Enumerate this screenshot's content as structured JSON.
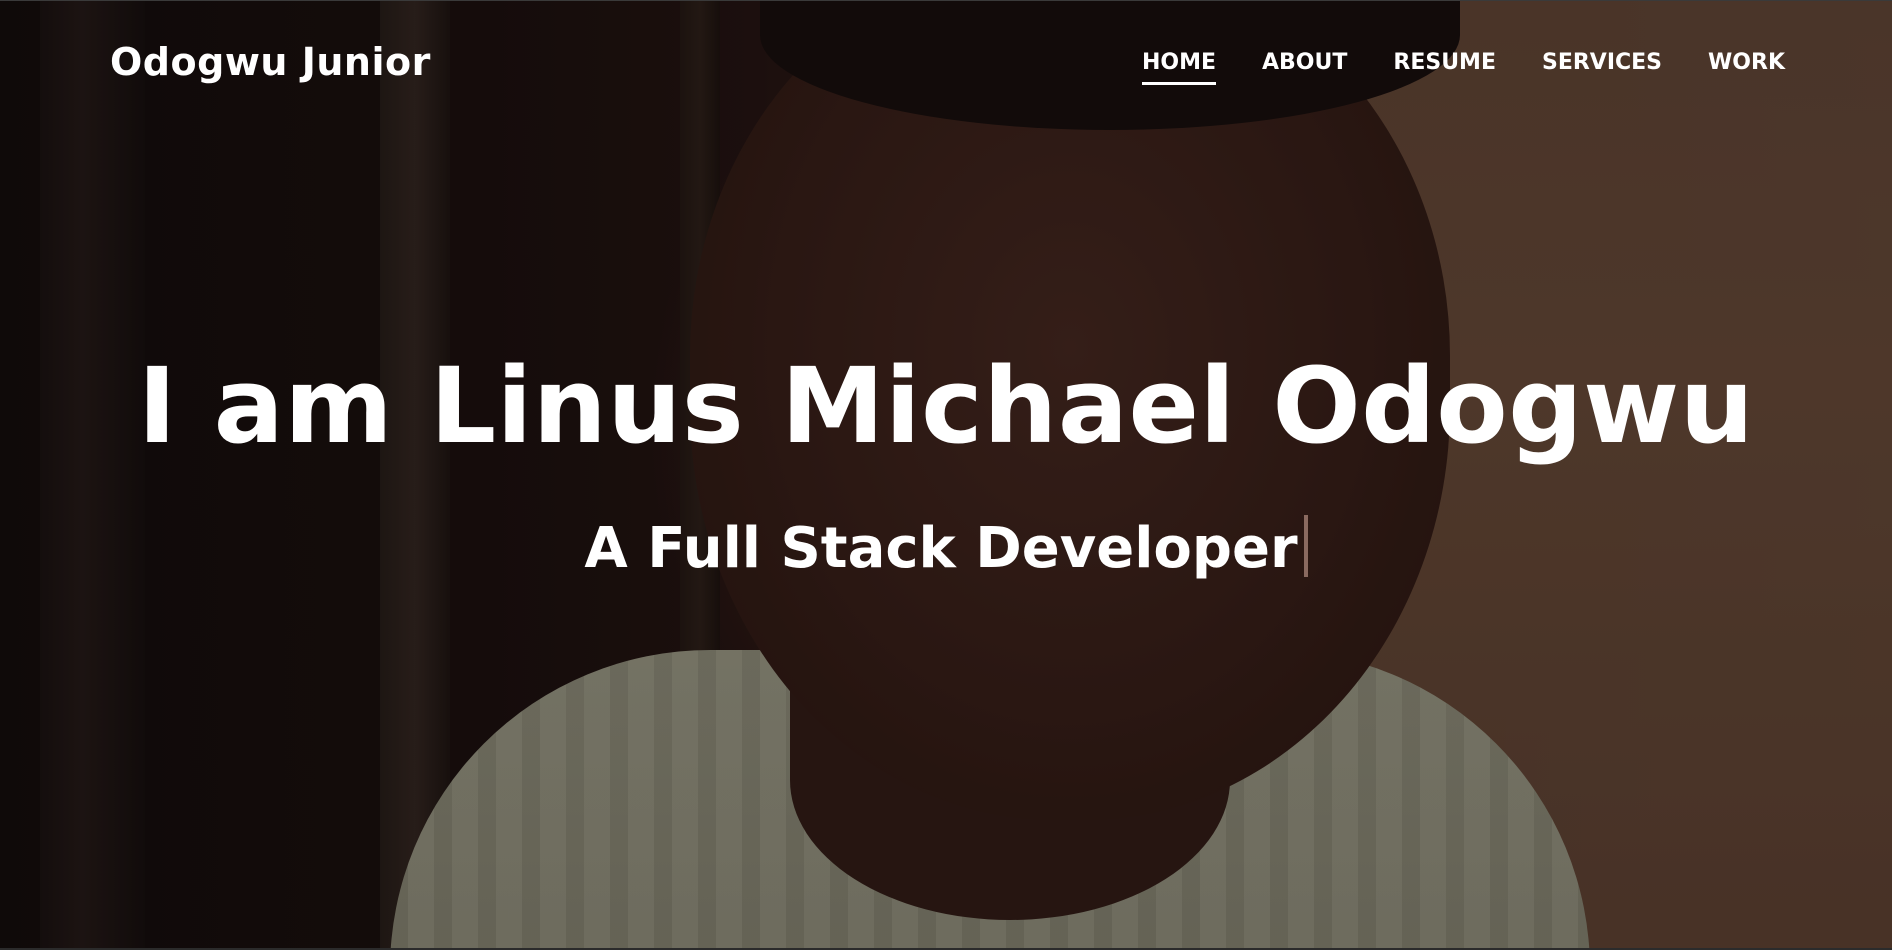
{
  "navbar": {
    "brand": "Odogwu Junior",
    "items": [
      {
        "label": "HOME",
        "active": true
      },
      {
        "label": "ABOUT",
        "active": false
      },
      {
        "label": "RESUME",
        "active": false
      },
      {
        "label": "SERVICES",
        "active": false
      },
      {
        "label": "WORK",
        "active": false
      }
    ]
  },
  "hero": {
    "title": "I am Linus Michael Odogwu",
    "subtitle": "A Full Stack Developer"
  }
}
